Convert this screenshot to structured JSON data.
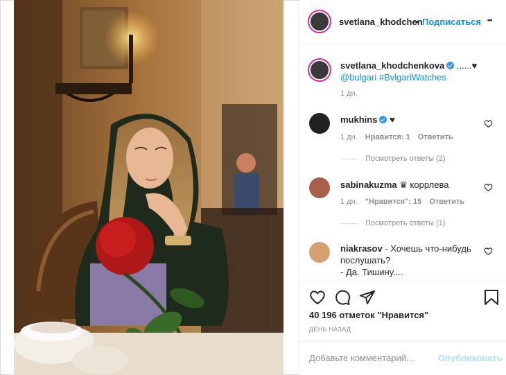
{
  "header": {
    "username": "svetlana_khodchen",
    "separator": "•",
    "follow": "Подписаться",
    "more": "•••"
  },
  "caption": {
    "username": "svetlana_khodchenkova",
    "text": "......♥",
    "mention": "@bulgari",
    "hashtag": "#BvlgariWatches",
    "time": "1 дн."
  },
  "comments": [
    {
      "username": "mukhins",
      "text": "♥",
      "time": "1 дн.",
      "likes": "Нравится: 1",
      "reply": "Ответить",
      "view_replies": "Посмотреть ответы (2)"
    },
    {
      "username": "sabinakuzma",
      "text": "♛ коррлева",
      "time": "1 дн.",
      "likes": "\"Нравится\": 15",
      "reply": "Ответить",
      "view_replies": "Посмотреть ответы (1)"
    },
    {
      "username": "niakrasov",
      "text_line1": "- Хочешь что-нибудь",
      "text_line2": "послушать?",
      "text_line3": "- Да. Тишину...."
    }
  ],
  "stats": {
    "likes": "40 196 отметок \"Нравится\"",
    "ago": "День назад"
  },
  "comment_box": {
    "placeholder": "Добавьте комментарий...",
    "publish": "Опубликовать"
  },
  "icons": {
    "like": "heart-icon",
    "comment": "comment-icon",
    "share": "share-icon",
    "save": "bookmark-icon",
    "more": "more-icon"
  },
  "colors": {
    "accent": "#0095f6",
    "verified": "#3897f0",
    "muted": "#8e8e8e",
    "publish_disabled": "#b2dffc",
    "rose": "#b01818"
  }
}
